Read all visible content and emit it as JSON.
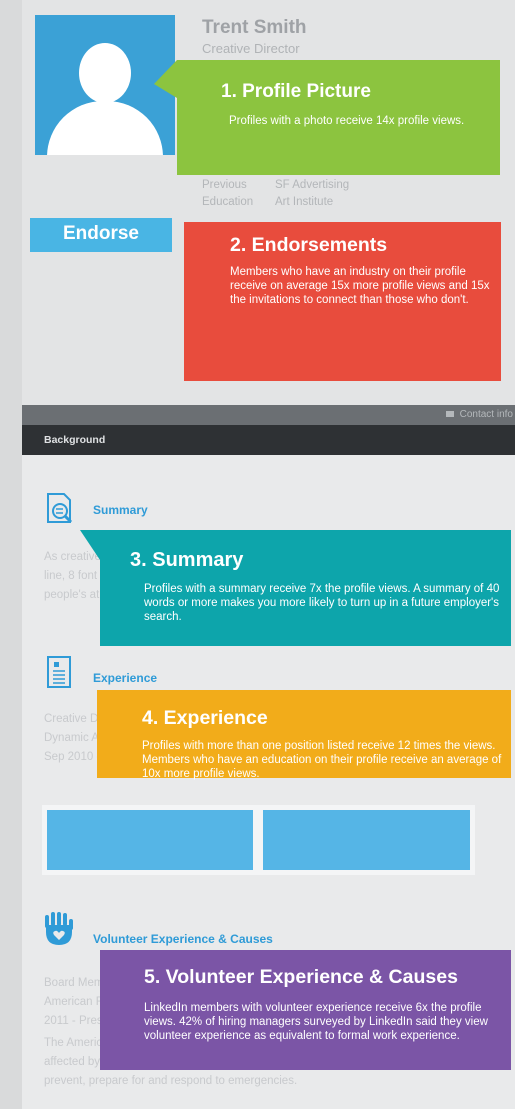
{
  "profile": {
    "name": "Trent Smith",
    "role": "Creative Director",
    "previous_label": "Previous",
    "previous_value": "SF Advertising",
    "education_label": "Education",
    "education_value": "Art Institute",
    "endorse_label": "Endorse"
  },
  "callouts": {
    "photo": {
      "title": "1. Profile Picture",
      "text": "Profiles with a photo receive 14x profile views."
    },
    "endorsements": {
      "title": "2. Endorsements",
      "text": "Members who have an industry on their profile receive on average 15x more profile views and 15x the invitations to connect than those who don't."
    },
    "summary": {
      "title": "3. Summary",
      "text": "Profiles with a summary receive 7x the profile views. A summary of 40 words or more makes you more likely to turn up in a future employer's search."
    },
    "experience": {
      "title": "4. Experience",
      "text": "Profiles with more than one position listed receive 12 times the views. Members who have an education on their profile receive an average of 10x more profile views."
    },
    "volunteer": {
      "title": "5. Volunteer Experience & Causes",
      "text": "LinkedIn members with volunteer experience receive 6x the profile views. 42% of hiring managers surveyed by LinkedIn said they view volunteer experience as equivalent to formal work experience."
    }
  },
  "bars": {
    "contact_label": "Contact info",
    "background_label": "Background"
  },
  "sections": {
    "summary_title": "Summary",
    "summary_lines": [
      "As creative",
      "line, 8 font",
      "people's at"
    ],
    "experience_title": "Experience",
    "experience_lines": [
      "Creative D",
      "Dynamic A",
      "Sep 2010 -"
    ],
    "volunteer_title": "Volunteer Experience & Causes",
    "volunteer_lines": [
      "Board Mem",
      "American F",
      "2011 - Pres"
    ],
    "volunteer_desc": [
      "The Americ",
      "affected by",
      "prevent, prepare for and respond to emergencies."
    ]
  },
  "colors": {
    "photo": "#8cc43f",
    "endorsements": "#e84c3d",
    "summary": "#0da5ab",
    "experience": "#f2ac1a",
    "volunteer": "#7b55a6",
    "accent_blue": "#3ba1d6"
  },
  "icons": [
    "avatar-silhouette-icon",
    "contact-card-icon",
    "summary-search-icon",
    "experience-document-icon",
    "volunteer-hand-heart-icon"
  ]
}
